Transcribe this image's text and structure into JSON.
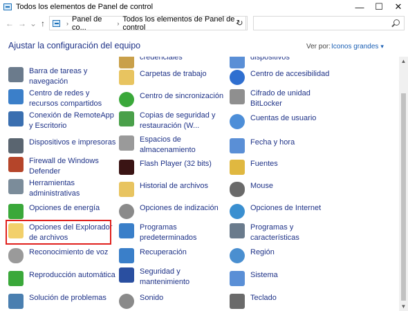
{
  "window": {
    "title": "Todos los elementos de Panel de control",
    "minimize": "—",
    "maximize": "☐",
    "close": "✕"
  },
  "nav": {
    "back": "←",
    "forward": "→",
    "recent": "⌄",
    "up": "↑",
    "breadcrumb_root": "Panel de co...",
    "breadcrumb_current": "Todos los elementos de Panel de control",
    "refresh": "↻",
    "search_placeholder": ""
  },
  "header": {
    "title": "Ajustar la configuración del equipo",
    "view_by_label": "Ver por:",
    "view_by_value": "Iconos grandes"
  },
  "items": [
    {
      "label": "credenciales",
      "icon": "credential-manager-icon",
      "color": "#c9a04a"
    },
    {
      "label": "dispositivos",
      "icon": "default-programs-icon",
      "color": "#5a8fd6"
    },
    {
      "label": "Barra de tareas y navegación",
      "icon": "taskbar-icon",
      "color": "#6b7b8c"
    },
    {
      "label": "Carpetas de trabajo",
      "icon": "work-folders-icon",
      "color": "#e8c460"
    },
    {
      "label": "Centro de accesibilidad",
      "icon": "ease-of-access-icon",
      "color": "#2f6fd0"
    },
    {
      "label": "Centro de redes y recursos compartidos",
      "icon": "network-icon",
      "color": "#3b7fc9"
    },
    {
      "label": "Centro de sincronización",
      "icon": "sync-center-icon",
      "color": "#3aa83a"
    },
    {
      "label": "Cifrado de unidad BitLocker",
      "icon": "bitlocker-icon",
      "color": "#8f8f8f"
    },
    {
      "label": "Conexión de RemoteApp y Escritorio",
      "icon": "remoteapp-icon",
      "color": "#3a6fb0"
    },
    {
      "label": "Copias de seguridad y restauración (W...",
      "icon": "backup-icon",
      "color": "#4aa04a"
    },
    {
      "label": "Cuentas de usuario",
      "icon": "user-accounts-icon",
      "color": "#4d8ed8"
    },
    {
      "label": "Dispositivos e impresoras",
      "icon": "devices-printers-icon",
      "color": "#5a6570"
    },
    {
      "label": "Espacios de almacenamiento",
      "icon": "storage-spaces-icon",
      "color": "#9a9a9a"
    },
    {
      "label": "Fecha y hora",
      "icon": "date-time-icon",
      "color": "#5a8fd6"
    },
    {
      "label": "Firewall de Windows Defender",
      "icon": "firewall-icon",
      "color": "#b5452a"
    },
    {
      "label": "Flash Player (32 bits)",
      "icon": "flash-player-icon",
      "color": "#3a1414"
    },
    {
      "label": "Fuentes",
      "icon": "fonts-icon",
      "color": "#e0b840"
    },
    {
      "label": "Herramientas administrativas",
      "icon": "admin-tools-icon",
      "color": "#7b8c9a"
    },
    {
      "label": "Historial de archivos",
      "icon": "file-history-icon",
      "color": "#e8c460"
    },
    {
      "label": "Mouse",
      "icon": "mouse-icon",
      "color": "#6a6a6a"
    },
    {
      "label": "Opciones de energía",
      "icon": "power-options-icon",
      "color": "#3aa83a"
    },
    {
      "label": "Opciones de indización",
      "icon": "indexing-icon",
      "color": "#8a8a8a"
    },
    {
      "label": "Opciones de Internet",
      "icon": "internet-options-icon",
      "color": "#3a8fd0"
    },
    {
      "label": "Opciones del Explorador de archivos",
      "icon": "explorer-options-icon",
      "color": "#f2d06b"
    },
    {
      "label": "Programas predeterminados",
      "icon": "default-programs-icon",
      "color": "#3a7fc9"
    },
    {
      "label": "Programas y características",
      "icon": "programs-features-icon",
      "color": "#6a7b8c"
    },
    {
      "label": "Reconocimiento de voz",
      "icon": "microphone-icon",
      "color": "#9a9a9a"
    },
    {
      "label": "Recuperación",
      "icon": "recovery-icon",
      "color": "#3a7fc9"
    },
    {
      "label": "Región",
      "icon": "region-icon",
      "color": "#4a8fd0"
    },
    {
      "label": "Reproducción automática",
      "icon": "autoplay-icon",
      "color": "#3aa83a"
    },
    {
      "label": "Seguridad y mantenimiento",
      "icon": "security-flag-icon",
      "color": "#2a4fa0"
    },
    {
      "label": "Sistema",
      "icon": "system-icon",
      "color": "#5a8fd6"
    },
    {
      "label": "Solución de problemas",
      "icon": "troubleshooting-icon",
      "color": "#4a7fb0"
    },
    {
      "label": "Sonido",
      "icon": "sound-icon",
      "color": "#8a8a8a"
    },
    {
      "label": "Teclado",
      "icon": "keyboard-icon",
      "color": "#6a6a6a"
    }
  ]
}
